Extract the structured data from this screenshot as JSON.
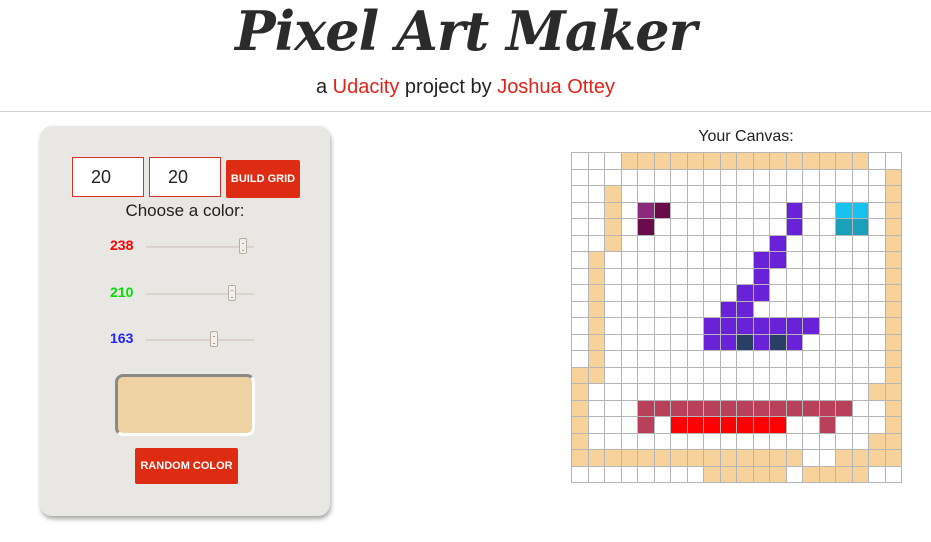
{
  "header": {
    "title": "Pixel Art Maker",
    "subtitle_prefix": "a ",
    "subtitle_brand": "Udacity",
    "subtitle_middle": " project by ",
    "subtitle_author": "Joshua Ottey"
  },
  "controls": {
    "height_value": "20",
    "width_value": "20",
    "build_label": "BUILD GRID",
    "choose_label": "Choose a color:",
    "sliders": [
      {
        "channel": "red",
        "value": "238",
        "color": "#ff0000",
        "fraction": 0.933
      },
      {
        "channel": "green",
        "value": "210",
        "color": "#00e000",
        "fraction": 0.824
      },
      {
        "channel": "blue",
        "value": "163",
        "color": "#2222ff",
        "fraction": 0.639
      }
    ],
    "swatch_color": "#eed2a3",
    "random_label": "RANDOM COLOR"
  },
  "canvas": {
    "label": "Your Canvas:",
    "rows": 20,
    "cols": 20,
    "palette": {
      "B": "#f7d39b",
      "P": "#6a22d8",
      "M": "#8b2a7c",
      "N": "#6a0b4b",
      "C": "#17c2ee",
      "T": "#1aa0ba",
      "D": "#2a3f66",
      "R": "#b8405a",
      "E": "#ff0000"
    },
    "grid": [
      "...BBBBBBBBBBBBBBB..",
      "...................B",
      "..B................B",
      "..B.MN.......P..CC.B",
      "..B.N........P..TT.B",
      "..B.........P......B",
      ".B.........PP......B",
      ".B.........P.......B",
      ".B........PP.......B",
      ".B.......PP........B",
      ".B......PPPPPPP....B",
      ".B......PPDPDP.....B",
      ".B.................B",
      "BB.................B",
      "B.................BB",
      "B...RRRRRRRRRRRRR..B",
      "B...R.EEEEEEE..R...B",
      "B.................BB",
      "BBBBBBBBBBBBBB..BBBB",
      "........BBBBB.BBBB.."
    ]
  }
}
